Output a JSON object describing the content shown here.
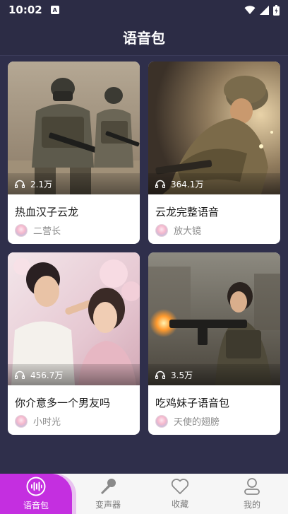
{
  "status_bar": {
    "time": "10:02",
    "notif_letter": "A"
  },
  "header": {
    "title": "语音包"
  },
  "cards": [
    {
      "title": "热血汉子云龙",
      "plays": "2.1万",
      "author": "二营长"
    },
    {
      "title": "云龙完整语音",
      "plays": "364.1万",
      "author": "放大镜"
    },
    {
      "title": "你介意多一个男友吗",
      "plays": "456.7万",
      "author": "小时光"
    },
    {
      "title": "吃鸡妹子语音包",
      "plays": "3.5万",
      "author": "天使的翅膀"
    }
  ],
  "tabs": [
    {
      "label": "语音包",
      "icon": "voice-wave-icon",
      "active": true
    },
    {
      "label": "变声器",
      "icon": "microphone-icon",
      "active": false
    },
    {
      "label": "收藏",
      "icon": "heart-icon",
      "active": false
    },
    {
      "label": "我的",
      "icon": "person-icon",
      "active": false
    }
  ],
  "colors": {
    "background": "#2c2c45",
    "accent": "#c42fe0"
  }
}
